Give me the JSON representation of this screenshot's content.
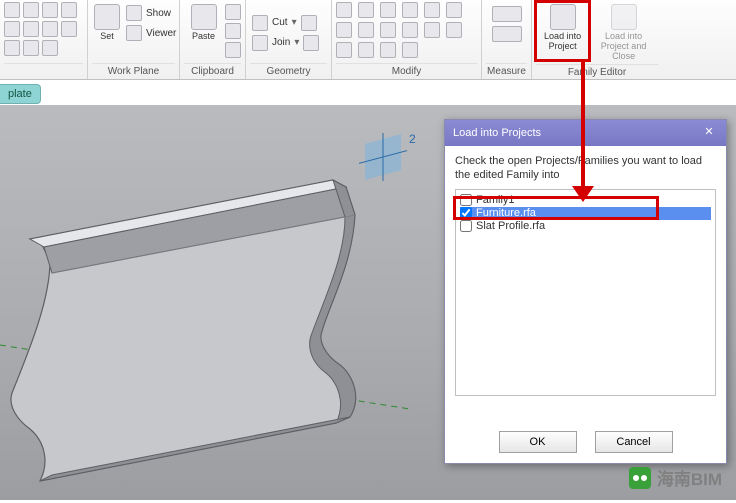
{
  "ribbon": {
    "groups": {
      "work_plane": {
        "label": "Work Plane",
        "set": "Set",
        "show": "Show",
        "viewer": "Viewer"
      },
      "clipboard": {
        "label": "Clipboard",
        "paste": "Paste"
      },
      "geometry": {
        "label": "Geometry",
        "cut": "Cut",
        "join": "Join"
      },
      "modify": {
        "label": "Modify"
      },
      "measure": {
        "label": "Measure"
      },
      "family_editor": {
        "label": "Family Editor",
        "load_into_project": "Load into Project",
        "load_into_project_close": "Load into Project and Close"
      }
    }
  },
  "plate_stub": "plate",
  "dialog": {
    "title": "Load into Projects",
    "instruction": "Check the open Projects/Families you want to load the edited Family into",
    "items": [
      {
        "label": "Family1",
        "checked": false
      },
      {
        "label": "Furniture.rfa",
        "checked": true
      },
      {
        "label": "Slat Profile.rfa",
        "checked": false
      }
    ],
    "ok": "OK",
    "cancel": "Cancel"
  },
  "viewport_axis_label": "2",
  "watermark": "海南BIM",
  "colors": {
    "highlight": "#d40000",
    "dialog_title": "#7d7dc8",
    "selection": "#5a8ff0"
  }
}
